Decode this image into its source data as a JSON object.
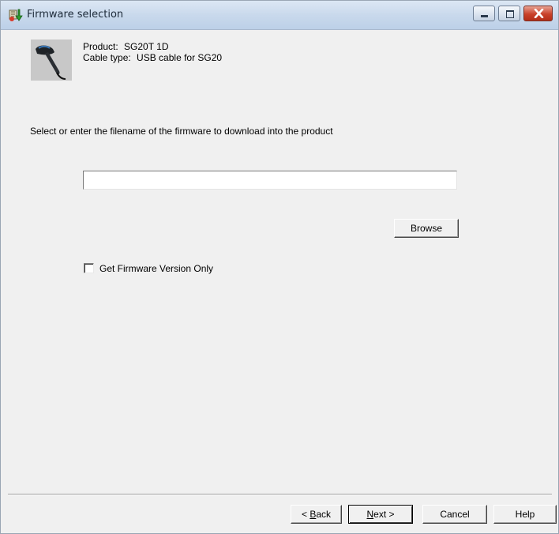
{
  "window": {
    "title": "Firmware selection"
  },
  "product": {
    "product_label": "Product:",
    "product_value": "SG20T 1D",
    "cable_label": "Cable type:",
    "cable_value": "USB cable for SG20"
  },
  "main": {
    "instruction": "Select or enter the filename of the firmware to download into the product",
    "filename_value": "",
    "browse_label": "Browse",
    "checkbox_label": "Get Firmware Version Only",
    "checkbox_checked": false
  },
  "footer": {
    "back_prefix": "< ",
    "back_accel": "B",
    "back_rest": "ack",
    "next_accel": "N",
    "next_rest": "ext >",
    "cancel_label": "Cancel",
    "help_label": "Help"
  }
}
